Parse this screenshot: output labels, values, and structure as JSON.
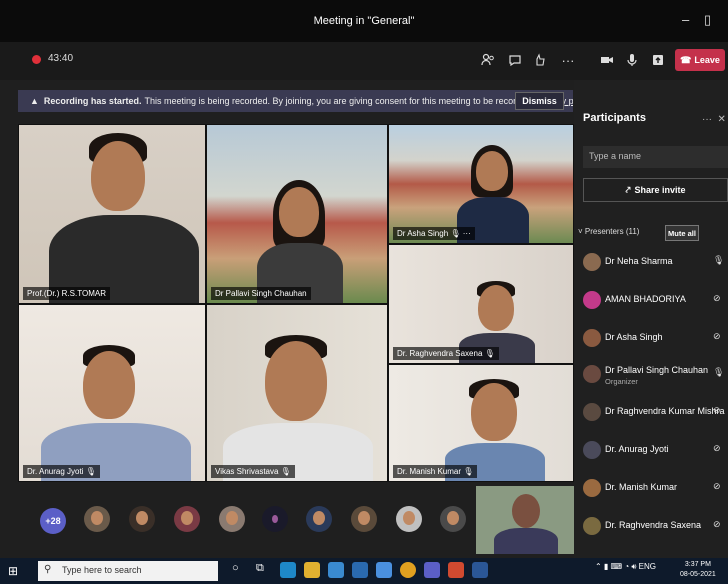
{
  "window": {
    "title": "Meeting in \"General\""
  },
  "call": {
    "timer": "43:40",
    "leave_label": "Leave",
    "icons": [
      "participants-icon",
      "chat-icon",
      "reactions-icon",
      "more-icon",
      "camera-icon",
      "mic-icon",
      "share-icon"
    ]
  },
  "banner": {
    "bold": "Recording has started.",
    "text": "This meeting is being recorded. By joining, you are giving consent for this meeting to be recorded.",
    "link": "Privacy policy",
    "dismiss": "Dismiss"
  },
  "tiles": [
    {
      "name": "Prof.(Dr.) R.S.TOMAR"
    },
    {
      "name": "Dr Pallavi Singh Chauhan"
    },
    {
      "name": "Dr Asha Singh"
    },
    {
      "name": "Dr. Raghvendra Saxena"
    },
    {
      "name": "Dr. Anurag Jyoti"
    },
    {
      "name": "Vikas Shrivastava"
    },
    {
      "name": "Dr. Manish Kumar"
    }
  ],
  "strip": {
    "overflow": "+28"
  },
  "participants": {
    "title": "Participants",
    "search_placeholder": "Type a name",
    "share_invite": "Share invite",
    "presenters_label": "Presenters (11)",
    "mute_all": "Mute all",
    "list": [
      {
        "name": "Dr Neha Sharma",
        "role": "",
        "mic": "on"
      },
      {
        "name": "AMAN BHADORIYA",
        "role": "",
        "mic": "off"
      },
      {
        "name": "Dr Asha Singh",
        "role": "",
        "mic": "off"
      },
      {
        "name": "Dr Pallavi Singh Chauhan",
        "role": "Organizer",
        "mic": "on"
      },
      {
        "name": "Dr Raghvendra Kumar Mishra",
        "role": "",
        "mic": "off"
      },
      {
        "name": "Dr. Anurag Jyoti",
        "role": "",
        "mic": "off"
      },
      {
        "name": "Dr. Manish Kumar",
        "role": "",
        "mic": "off"
      },
      {
        "name": "Dr. Raghvendra Saxena",
        "role": "",
        "mic": "off"
      }
    ]
  },
  "taskbar": {
    "search_placeholder": "Type here to search",
    "lang": "ENG",
    "time": "3:37 PM",
    "date": "08-05-2021"
  },
  "colors": {
    "leave": "#c4314b",
    "accent": "#5b5fc7",
    "recording": "#e0303a",
    "taskbar": "#0e1a2b"
  }
}
